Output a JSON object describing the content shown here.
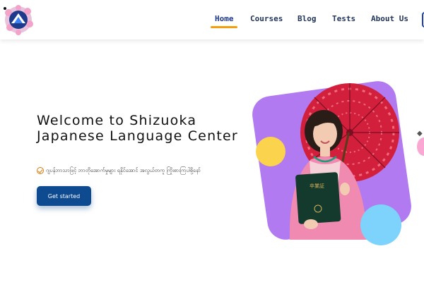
{
  "nav": {
    "items": [
      {
        "label": "Home",
        "active": true
      },
      {
        "label": "Courses"
      },
      {
        "label": "Blog"
      },
      {
        "label": "Tests"
      },
      {
        "label": "About Us"
      }
    ]
  },
  "hero": {
    "title": "Welcome to Shizuoka Japanese Language Center",
    "tagline": "ဂျပန်ဘာသာဖြင့် ဘာတိုအောက်မှုများ ရနိုင်အောင် အလွယ်တကူ ကြိုးစားကြပါစို့နော်",
    "cta_label": "Get started"
  },
  "colors": {
    "accent": "#f59e0b",
    "primary": "#0e4a8f",
    "blob": "#b27af0",
    "yellow": "#fcd34d",
    "blue": "#7dd3fc"
  },
  "icons": {
    "logo": "mt-fuji-logo-icon",
    "tagline": "check-circle-icon",
    "diamond": "diamond-icon"
  }
}
